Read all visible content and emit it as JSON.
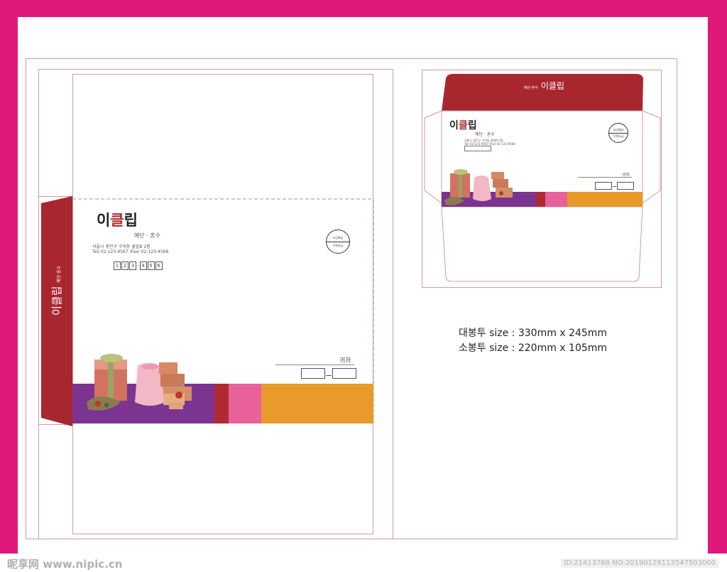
{
  "colors": {
    "border": "#e0187a",
    "flap_red": "#a8262e",
    "purple": "#7b3490",
    "red": "#b02a34",
    "pink": "#e8619a",
    "orange": "#e89a2a",
    "guide": "#cf9aa3"
  },
  "brand": {
    "name_a": "이",
    "name_b": "클",
    "name_c": "립",
    "tagline": "예단 · 혼수",
    "flap_logo": "이클립",
    "flap_small": "예단·혼수"
  },
  "address": {
    "line1": "서울시 광진구 구의동 클립B 2층",
    "line2": "Tel/ 02-123-4567 /Fax/ 02-123-4568",
    "zip_digits": [
      "1",
      "2",
      "3",
      "4",
      "5",
      "6"
    ],
    "zip_separator": "-"
  },
  "recipient": {
    "label": "귀하"
  },
  "stamp": {
    "top": "요금별납",
    "bottom": "우편요금"
  },
  "specs": {
    "large": "대봉투 size : 330mm x 245mm",
    "small": "소봉투 size : 220mm x 105mm"
  },
  "watermark": {
    "left": "昵享网 www.nipic.cn",
    "right": "ID:21413768 NO:20190129113547503000"
  }
}
